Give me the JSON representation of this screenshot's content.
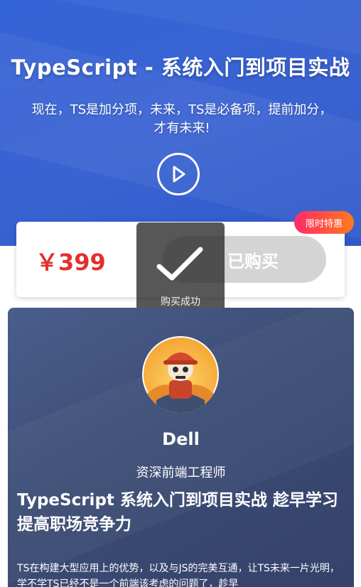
{
  "hero": {
    "title": "TypeScript  - 系统入门到项目实战",
    "subtitle": "现在，TS是加分项，未来，TS是必备项，提前加分，才有未来!",
    "play_icon": "play-icon"
  },
  "price_card": {
    "price": "￥399",
    "buy_label": "已购买",
    "badge": "限时特惠"
  },
  "toast": {
    "icon": "checkmark-icon",
    "message": "购买成功"
  },
  "author": {
    "name": "Dell",
    "role": "资深前端工程师",
    "course_title": "TypeScript 系统入门到项目实战 趁早学习提高职场竞争力",
    "description": "TS在构建大型应用上的优势，以及与JS的完美互通，让TS未来一片光明，学不学TS已经不是一个前端该考虑的问题了，趁早"
  },
  "colors": {
    "hero_bg": "#3564d6",
    "price": "#e42f2f",
    "buy_disabled": "#d4d4d4",
    "badge_start": "#ff2b6a",
    "badge_end": "#ff7a1f",
    "author_bg": "#3c4c74"
  }
}
